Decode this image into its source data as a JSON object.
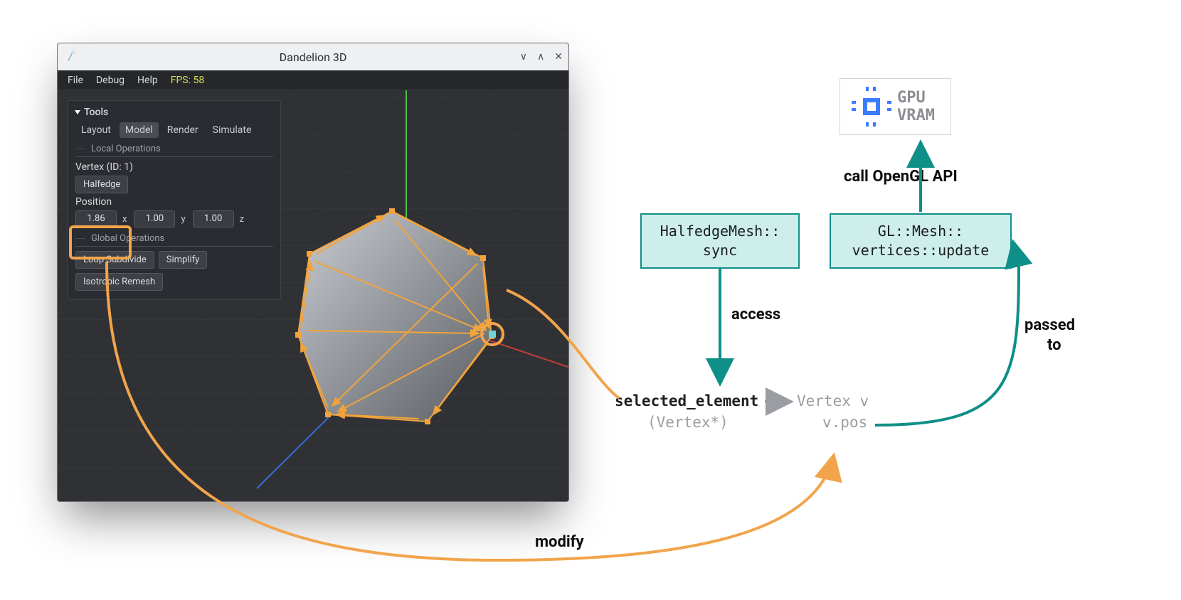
{
  "window": {
    "title": "Dandelion 3D",
    "menu": {
      "file": "File",
      "debug": "Debug",
      "help": "Help",
      "fps": "FPS: 58"
    }
  },
  "tools": {
    "header": "Tools",
    "tabs": {
      "layout": "Layout",
      "model": "Model",
      "render": "Render",
      "simulate": "Simulate"
    },
    "local_title": "Local Operations",
    "vertex_label": "Vertex (ID: 1)",
    "halfedge": "Halfedge",
    "position_label": "Position",
    "x": "1.86",
    "y": "1.00",
    "z": "1.00",
    "ax": "x",
    "ay": "y",
    "az": "z",
    "global_title": "Global Operations",
    "loop": "Loop Subdivide",
    "simplify": "Simplify",
    "iso": "Isotropic Remesh"
  },
  "diagram": {
    "halfedge_sync_l1": "HalfedgeMesh::",
    "halfedge_sync_l2": "sync",
    "gl_update_l1": "GL::Mesh::",
    "gl_update_l2": "vertices::update",
    "gpu_l1": "GPU",
    "gpu_l2": "VRAM",
    "access": "access",
    "call_api": "call OpenGL API",
    "passed_to_l1": "passed",
    "passed_to_l2": "to",
    "modify": "modify",
    "selected_element": "selected_element",
    "vertex_star": "(Vertex*)",
    "vertex_v": "Vertex v",
    "vpos": "v.pos"
  }
}
